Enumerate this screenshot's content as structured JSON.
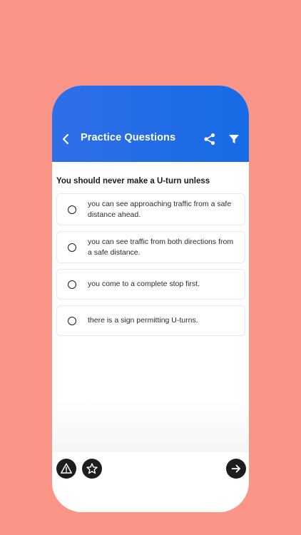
{
  "header": {
    "title": "Practice Questions",
    "back_icon": "chevron-left-icon",
    "share_icon": "share-icon",
    "filter_icon": "filter-icon"
  },
  "question": {
    "text": "You should never make a U-turn unless"
  },
  "options": [
    {
      "text": "you can see approaching traffic from a safe distance ahead."
    },
    {
      "text": "you can see traffic from both directions from a safe distance."
    },
    {
      "text": "you come to a complete stop first."
    },
    {
      "text": "there is a sign permitting U-turns."
    }
  ],
  "footer": {
    "report_icon": "warning-icon",
    "bookmark_icon": "star-icon",
    "next_icon": "arrow-right-icon"
  },
  "colors": {
    "background": "#fb9588",
    "header": "#1f6be6",
    "button": "#1d1d1f"
  }
}
